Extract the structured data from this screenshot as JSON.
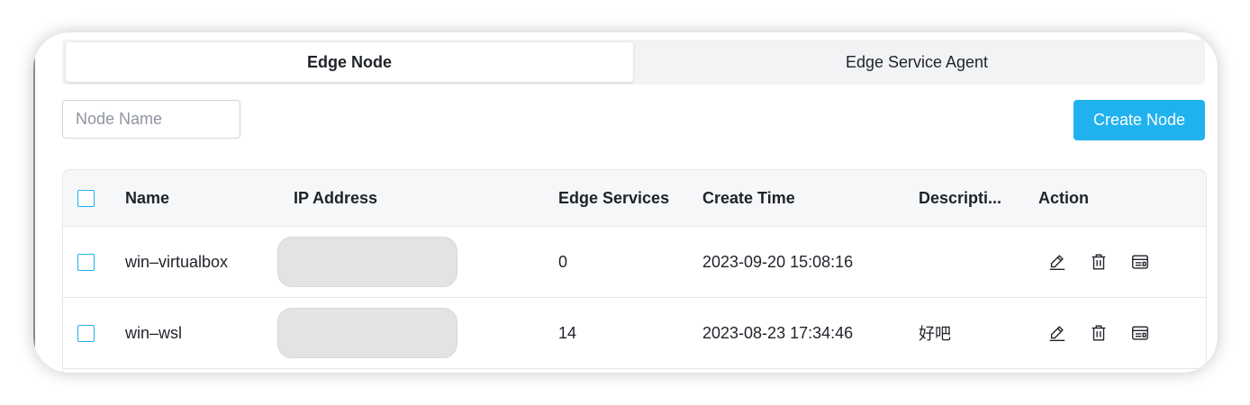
{
  "tabs": [
    {
      "label": "Edge Node",
      "active": true
    },
    {
      "label": "Edge Service Agent",
      "active": false
    }
  ],
  "search": {
    "placeholder": "Node Name",
    "value": ""
  },
  "toolbar": {
    "create_label": "Create Node",
    "create_color": "#20b2ee"
  },
  "table": {
    "headers": {
      "name": "Name",
      "ip": "IP Address",
      "services": "Edge Services",
      "create_time": "Create Time",
      "description": "Descripti...",
      "action": "Action"
    },
    "rows": [
      {
        "name": "win–virtualbox",
        "ip": "",
        "services": "0",
        "create_time": "2023-09-20 15:08:16",
        "description": ""
      },
      {
        "name": "win–wsl",
        "ip": "",
        "services": "14",
        "create_time": "2023-08-23 17:34:46",
        "description": "好吧"
      }
    ],
    "action_icons": [
      "edit-icon",
      "delete-icon",
      "console-icon"
    ]
  }
}
